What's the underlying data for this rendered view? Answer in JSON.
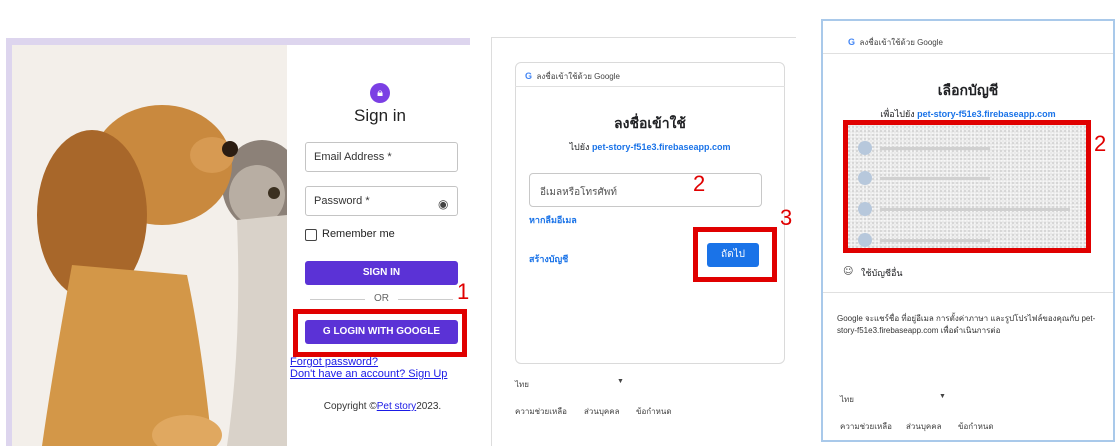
{
  "panel1": {
    "title": "Sign in",
    "email_label": "Email Address *",
    "password_label": "Password *",
    "remember": "Remember me",
    "sign_in": "SIGN IN",
    "or": "OR",
    "google_button": "LOGIN WITH GOOGLE",
    "forgot": "Forgot password?",
    "signup": "Don't have an account? Sign Up",
    "copyright_prefix": "Copyright ©",
    "copyright_link": "Pet story",
    "copyright_suffix": "2023.",
    "step": "1"
  },
  "panel2": {
    "header": "ลงชื่อเข้าใช้ด้วย Google",
    "title": "ลงชื่อเข้าใช้",
    "subtitle_prefix": "ไปยัง",
    "domain": "pet-story-f51e3.firebaseapp.com",
    "input_placeholder": "อีเมลหรือโทรศัพท์",
    "forgot_email": "หากลืมอีเมล",
    "create_account": "สร้างบัญชี",
    "next": "ถัดไป",
    "language": "ไทย",
    "footer": [
      "ความช่วยเหลือ",
      "ส่วนบุคคล",
      "ข้อกำหนด"
    ],
    "step_input": "2",
    "step_next": "3"
  },
  "panel3": {
    "header": "ลงชื่อเข้าใช้ด้วย Google",
    "title": "เลือกบัญชี",
    "subtitle_prefix": "เพื่อไปยัง",
    "domain": "pet-story-f51e3.firebaseapp.com",
    "use_other": "ใช้บัญชีอื่น",
    "description": "Google จะแชร์ชื่อ ที่อยู่อีเมล การตั้งค่าภาษา และรูปโปรไฟล์ของคุณกับ pet-story-f51e3.firebaseapp.com เพื่อดำเนินการต่อ",
    "language": "ไทย",
    "footer": [
      "ความช่วยเหลือ",
      "ส่วนบุคคล",
      "ข้อกำหนด"
    ],
    "step": "2"
  },
  "colors": {
    "accent": "#5b32d6",
    "google_blue": "#1a73e8",
    "highlight_red": "#e00000"
  }
}
